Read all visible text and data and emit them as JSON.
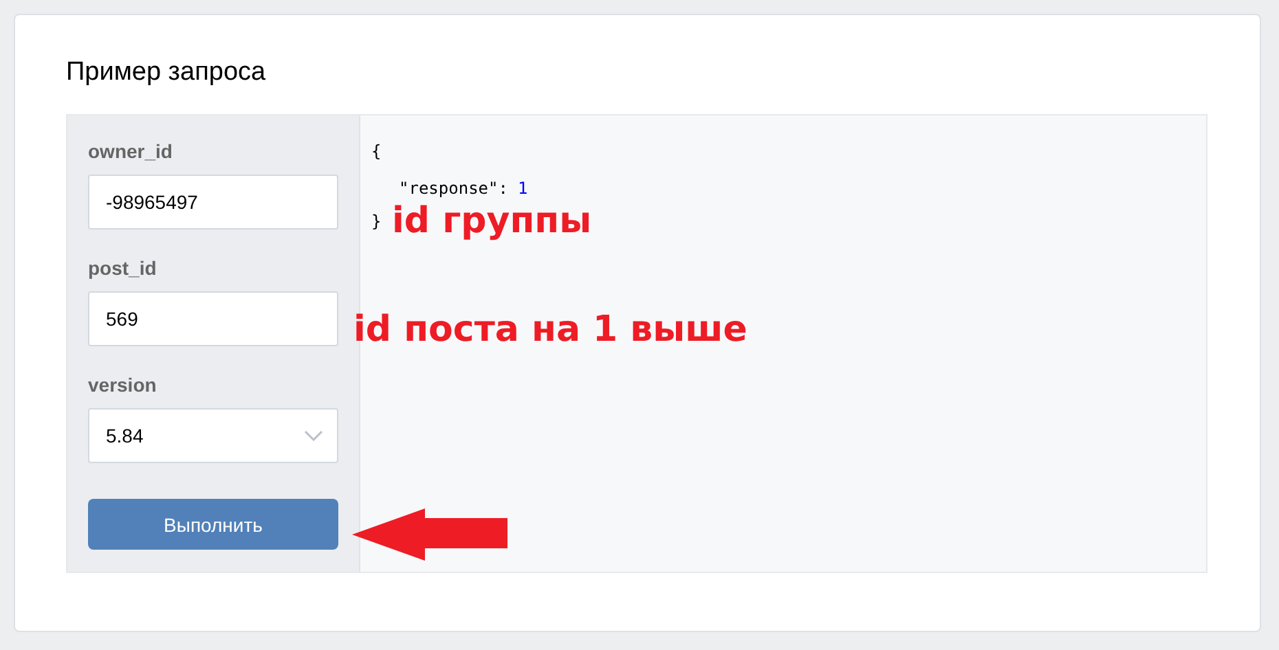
{
  "card": {
    "title": "Пример запроса"
  },
  "params": [
    {
      "label": "owner_id",
      "kind": "input",
      "value": "-98965497"
    },
    {
      "label": "post_id",
      "kind": "input",
      "value": "569"
    },
    {
      "label": "version",
      "kind": "select",
      "value": "5.84"
    }
  ],
  "button": "Выполнить",
  "response": {
    "open": "{",
    "key": "\"response\"",
    "colon": ":",
    "value": "1",
    "close": "}"
  },
  "annotations": [
    {
      "kind": "text",
      "text": "id группы"
    },
    {
      "kind": "text",
      "text": "id поста на 1 выше"
    },
    {
      "kind": "arrow"
    }
  ]
}
